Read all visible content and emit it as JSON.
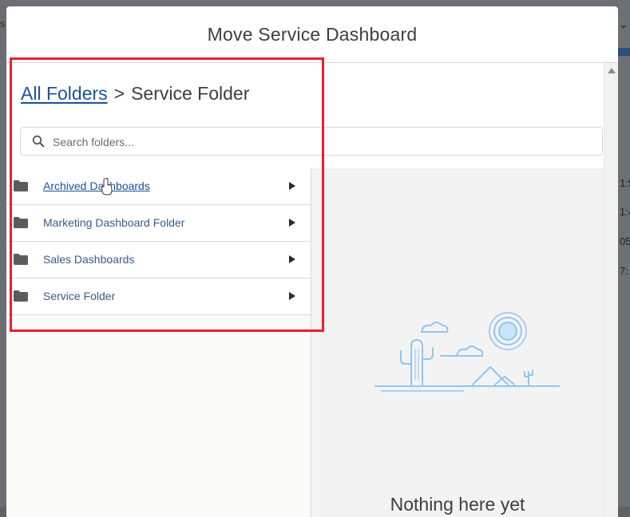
{
  "background": {
    "left_fragment": "s",
    "right_fragments": [
      "1:5",
      "1:4",
      "05",
      "7:"
    ],
    "right_chevron": "chevron-down-icon"
  },
  "modal": {
    "title": "Move Service Dashboard"
  },
  "breadcrumb": {
    "root_link": "All Folders",
    "separator": ">",
    "current": "Service Folder"
  },
  "search": {
    "placeholder": "Search folders...",
    "value": "",
    "icon": "search-icon"
  },
  "folders": [
    {
      "label": "Archived Dashboards",
      "icon": "folder-icon",
      "arrow": "chevron-right-icon",
      "hovered": true
    },
    {
      "label": "Marketing Dashboard Folder",
      "icon": "folder-icon",
      "arrow": "chevron-right-icon",
      "hovered": false
    },
    {
      "label": "Sales Dashboards",
      "icon": "folder-icon",
      "arrow": "chevron-right-icon",
      "hovered": false
    },
    {
      "label": "Service Folder",
      "icon": "folder-icon",
      "arrow": "chevron-right-icon",
      "hovered": false
    }
  ],
  "preview": {
    "empty_message": "Nothing here yet",
    "illustration": "desert-cactus-illustration"
  },
  "colors": {
    "link": "#1b5297",
    "highlight": "#e8202a",
    "illustration": "#8fc7ef"
  }
}
